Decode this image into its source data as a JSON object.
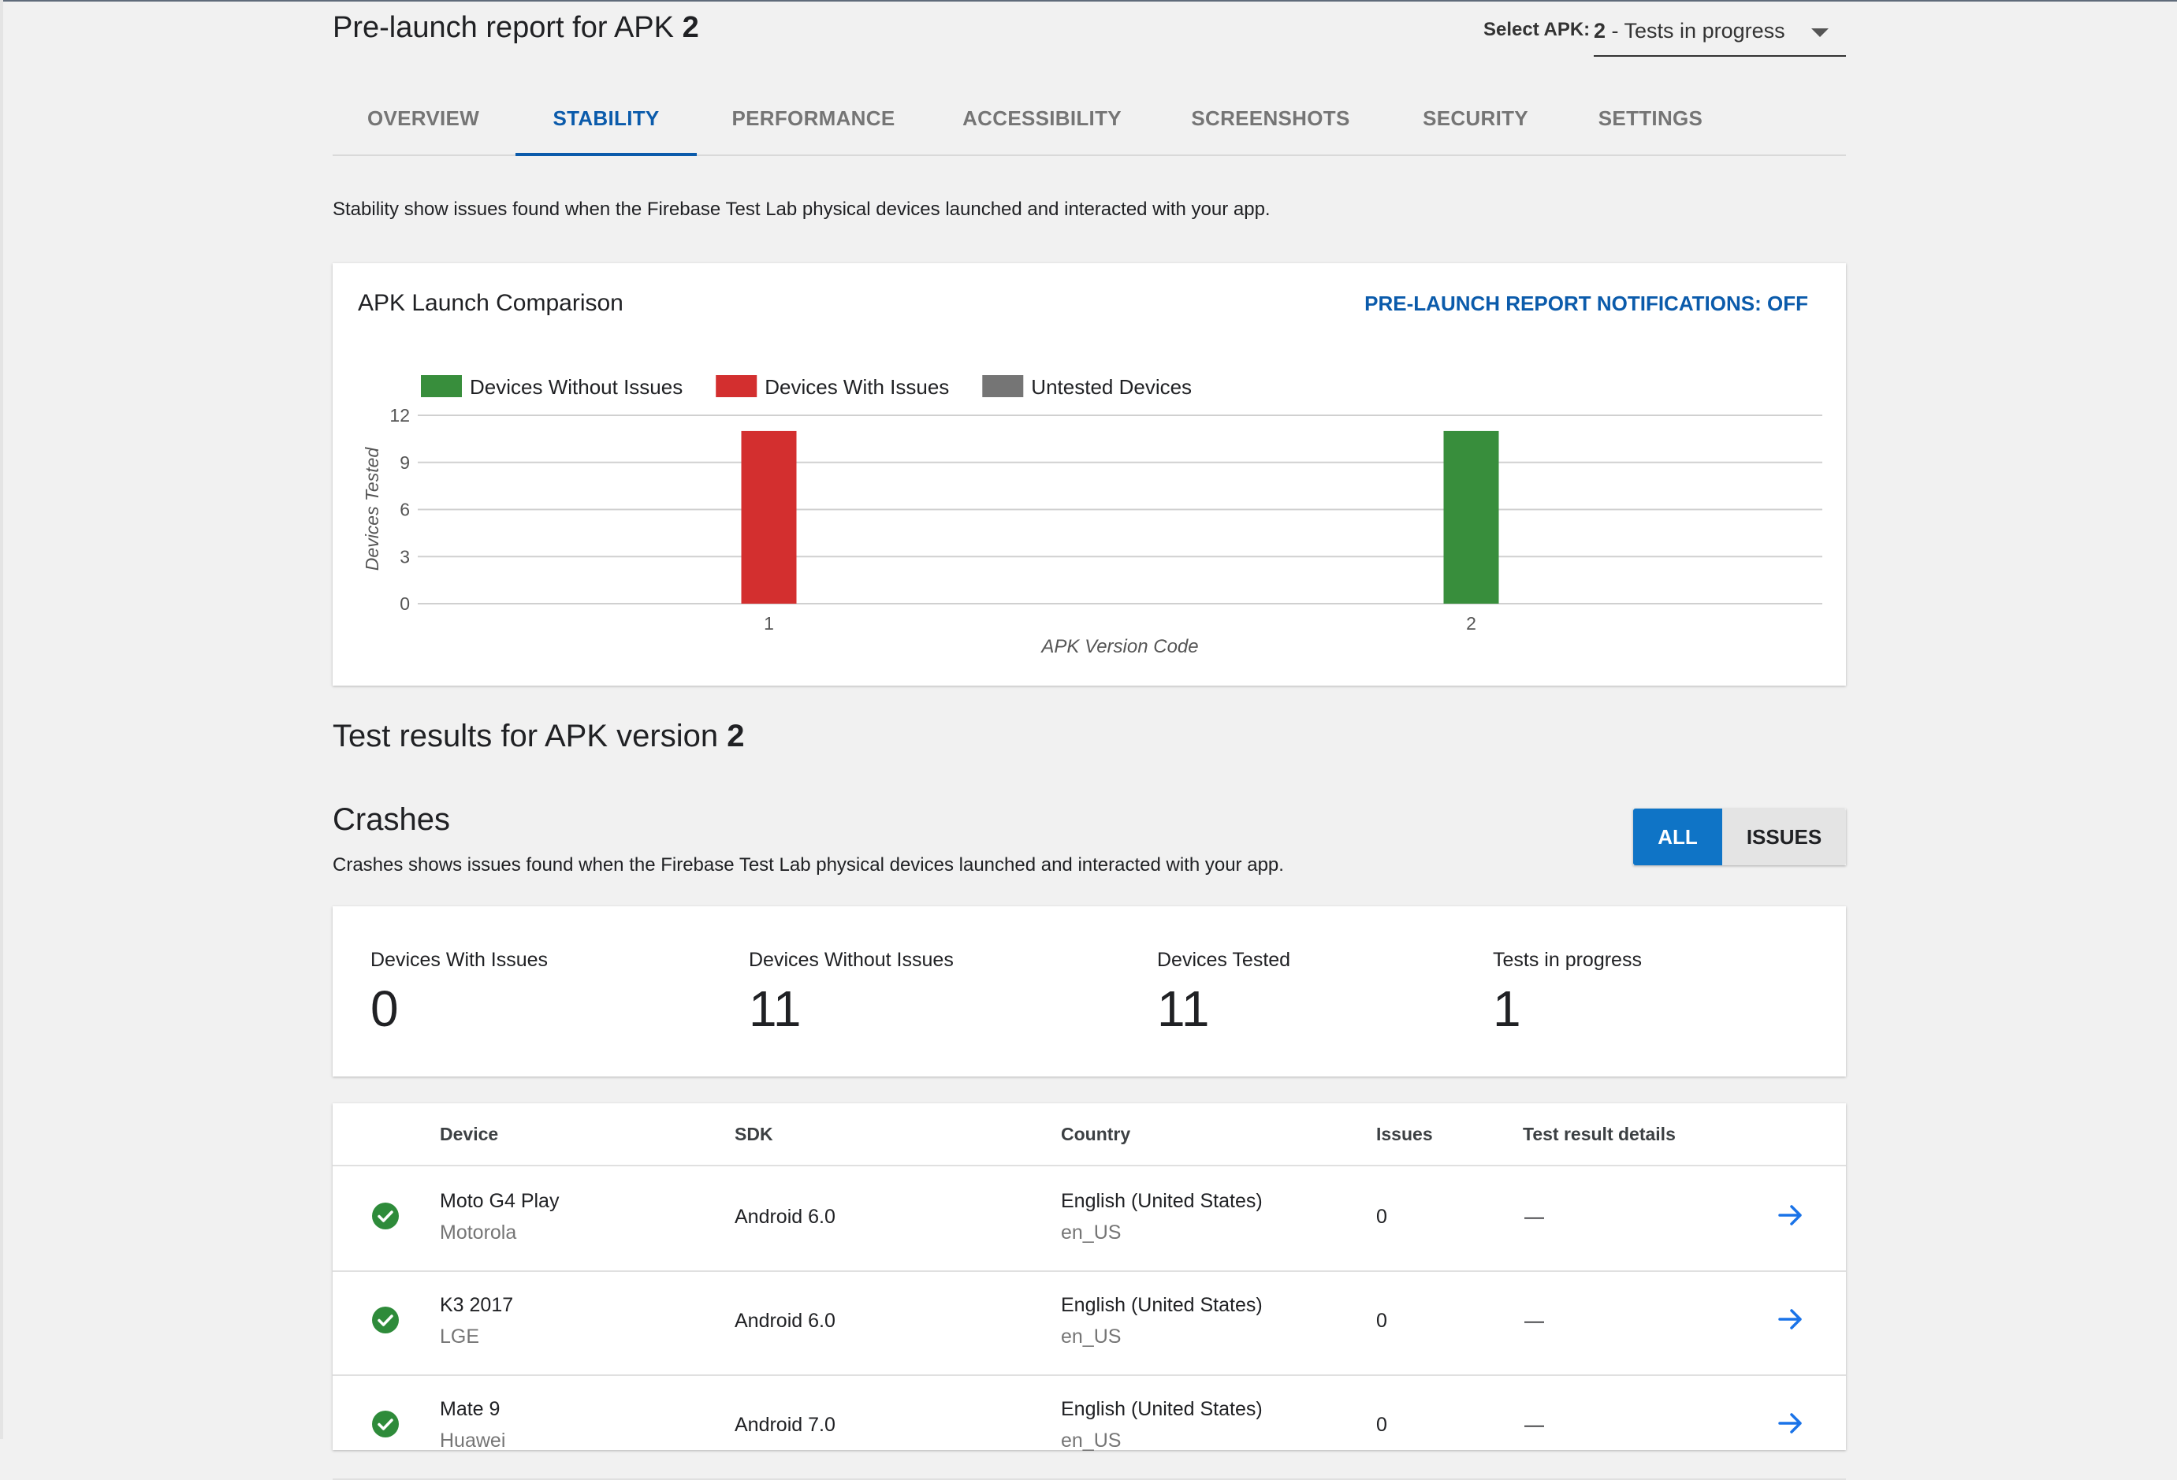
{
  "header": {
    "title_prefix": "Pre-launch report for APK",
    "title_apk": "2",
    "select_label": "Select APK:",
    "select_value_bold": "2",
    "select_value_rest": " - Tests in progress"
  },
  "tabs": [
    {
      "label": "OVERVIEW"
    },
    {
      "label": "STABILITY"
    },
    {
      "label": "PERFORMANCE"
    },
    {
      "label": "ACCESSIBILITY"
    },
    {
      "label": "SCREENSHOTS"
    },
    {
      "label": "SECURITY"
    },
    {
      "label": "SETTINGS"
    }
  ],
  "active_tab": "STABILITY",
  "stability_description": "Stability show issues found when the Firebase Test Lab physical devices launched and interacted with your app.",
  "chart_card": {
    "title": "APK Launch Comparison",
    "notifications_link": "PRE-LAUNCH REPORT NOTIFICATIONS: OFF"
  },
  "chart_data": {
    "type": "bar",
    "categories": [
      "1",
      "2"
    ],
    "series": [
      {
        "name": "Devices Without Issues",
        "color": "#388e3c",
        "values": [
          0,
          11
        ]
      },
      {
        "name": "Devices With Issues",
        "color": "#d32f2f",
        "values": [
          11,
          0
        ]
      },
      {
        "name": "Untested Devices",
        "color": "#757575",
        "values": [
          0,
          0
        ]
      }
    ],
    "xlabel": "APK Version Code",
    "ylabel": "Devices Tested",
    "ylim": [
      0,
      12
    ],
    "yticks": [
      "0",
      "3",
      "6",
      "9",
      "12"
    ],
    "legend": "top-left",
    "grid": true
  },
  "results": {
    "heading_prefix": "Test results for APK version",
    "heading_apk": "2"
  },
  "crashes": {
    "heading": "Crashes",
    "description": "Crashes shows issues found when the Firebase Test Lab physical devices launched and interacted with your app.",
    "filter_all": "ALL",
    "filter_issues": "ISSUES"
  },
  "stats": [
    {
      "label": "Devices With Issues",
      "value": "0"
    },
    {
      "label": "Devices Without Issues",
      "value": "11"
    },
    {
      "label": "Devices Tested",
      "value": "11"
    },
    {
      "label": "Tests in progress",
      "value": "1"
    }
  ],
  "table": {
    "columns": [
      "Device",
      "SDK",
      "Country",
      "Issues",
      "Test result details"
    ],
    "rows": [
      {
        "device": "Moto G4 Play",
        "maker": "Motorola",
        "sdk": "Android 6.0",
        "country": "English (United States)",
        "locale": "en_US",
        "issues": "0",
        "details": "—"
      },
      {
        "device": "K3 2017",
        "maker": "LGE",
        "sdk": "Android 6.0",
        "country": "English (United States)",
        "locale": "en_US",
        "issues": "0",
        "details": "—"
      },
      {
        "device": "Mate 9",
        "maker": "Huawei",
        "sdk": "Android 7.0",
        "country": "English (United States)",
        "locale": "en_US",
        "issues": "0",
        "details": "—"
      }
    ]
  }
}
